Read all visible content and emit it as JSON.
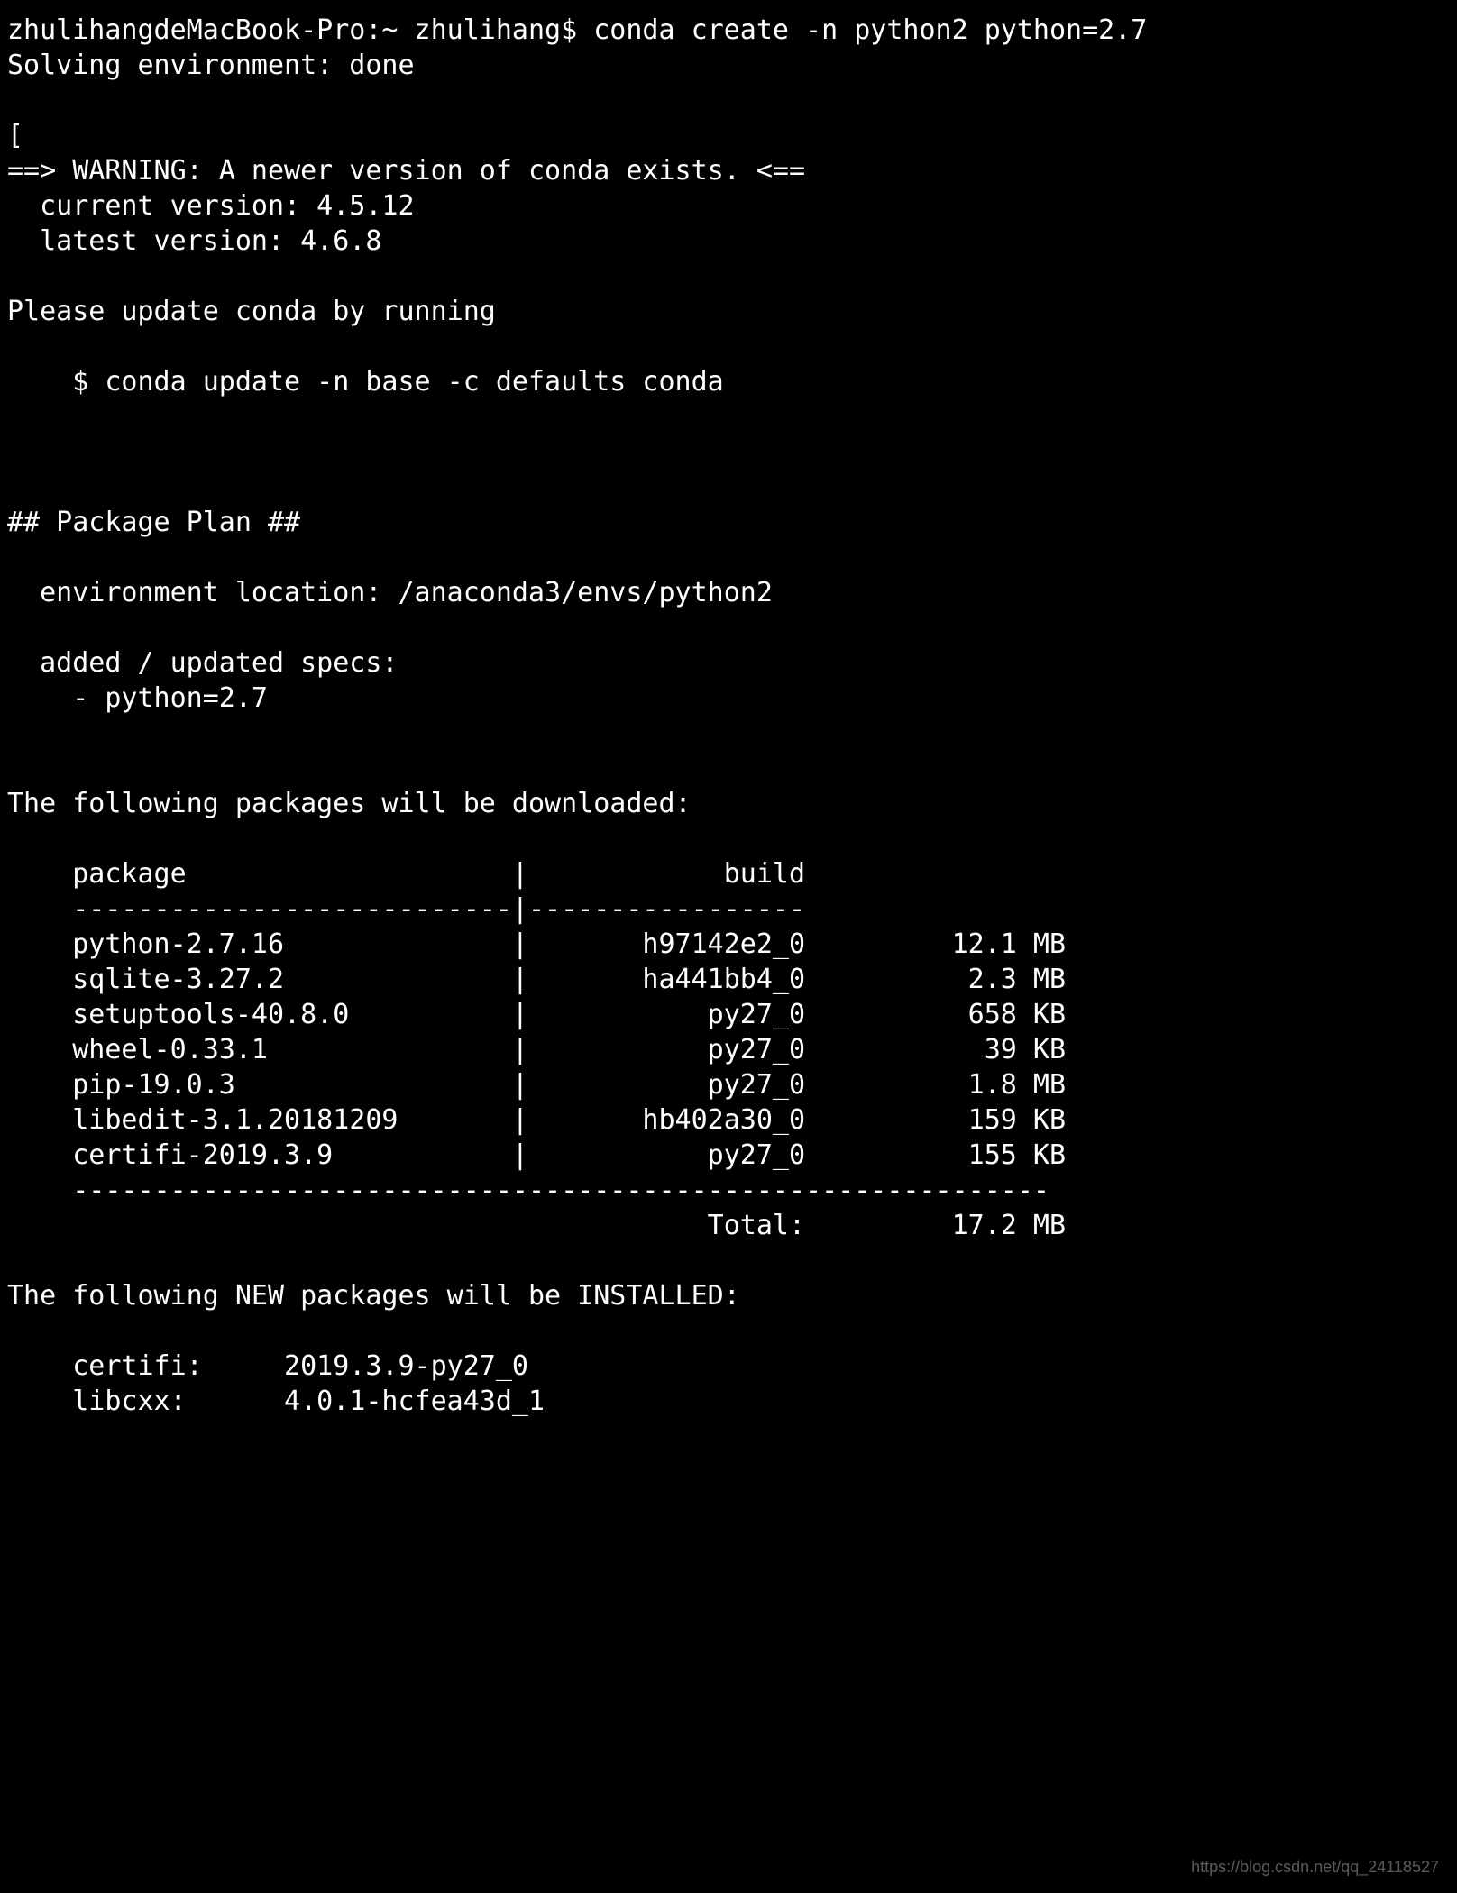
{
  "prompt": {
    "host": "zhulihangdeMacBook-Pro",
    "path": "~",
    "user": "zhulihang",
    "command": "conda create -n python2 python=2.7"
  },
  "solving_line": "Solving environment: done",
  "blank": "",
  "bracket_line": "[",
  "warning": {
    "title": "==> WARNING: A newer version of conda exists. <==",
    "current": "  current version: 4.5.12",
    "latest": "  latest version: 4.6.8",
    "please": "Please update conda by running",
    "cmd": "    $ conda update -n base -c defaults conda"
  },
  "plan": {
    "header": "## Package Plan ##",
    "env_loc_label": "  environment location: ",
    "env_loc_value": "/anaconda3/envs/python2",
    "added_label": "  added / updated specs: ",
    "spec1": "    - python=2.7"
  },
  "downloads": {
    "intro": "The following packages will be downloaded:",
    "header": "    package                    |            build",
    "sep": "    ---------------------------|-----------------",
    "rows": [
      {
        "pkg": "python-2.7.16",
        "build": "h97142e2_0",
        "size": "12.1 MB"
      },
      {
        "pkg": "sqlite-3.27.2",
        "build": "ha441bb4_0",
        "size": "2.3 MB"
      },
      {
        "pkg": "setuptools-40.8.0",
        "build": "py27_0",
        "size": "658 KB"
      },
      {
        "pkg": "wheel-0.33.1",
        "build": "py27_0",
        "size": "39 KB"
      },
      {
        "pkg": "pip-19.0.3",
        "build": "py27_0",
        "size": "1.8 MB"
      },
      {
        "pkg": "libedit-3.1.20181209",
        "build": "hb402a30_0",
        "size": "159 KB"
      },
      {
        "pkg": "certifi-2019.3.9",
        "build": "py27_0",
        "size": "155 KB"
      }
    ],
    "footer_sep": "    ------------------------------------------------------------",
    "total_label": "Total:",
    "total_value": "17.2 MB"
  },
  "installed": {
    "intro": "The following NEW packages will be INSTALLED:",
    "rows": [
      {
        "name": "certifi:",
        "ver": "2019.3.9-py27_0"
      },
      {
        "name": "libcxx:",
        "ver": "4.0.1-hcfea43d_1"
      }
    ]
  },
  "watermark": "https://blog.csdn.net/qq_24118527"
}
